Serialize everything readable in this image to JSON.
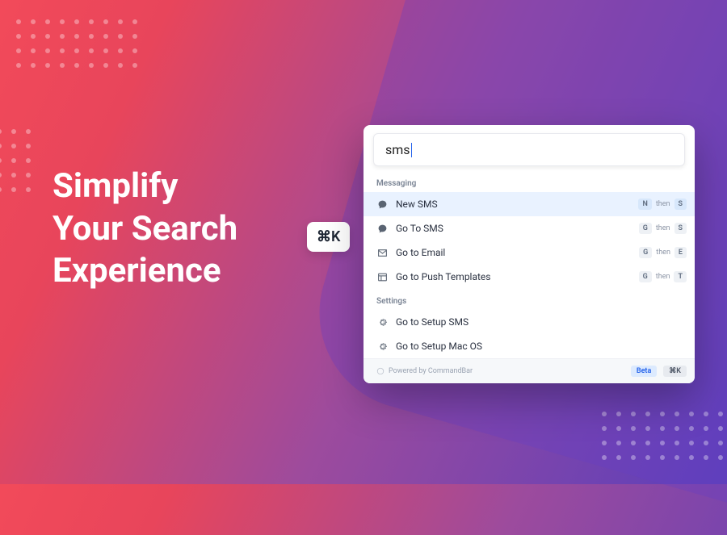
{
  "headline": {
    "line1": "Simplify",
    "line2": "Your Search",
    "line3": "Experience"
  },
  "shortcut_badge": "⌘K",
  "search": {
    "value": "sms",
    "placeholder": ""
  },
  "sections": [
    {
      "title": "Messaging",
      "items": [
        {
          "icon": "bubble",
          "label": "New SMS",
          "keys": [
            "N",
            "S"
          ],
          "selected": true
        },
        {
          "icon": "bubble",
          "label": "Go To SMS",
          "keys": [
            "G",
            "S"
          ]
        },
        {
          "icon": "mail",
          "label": "Go to Email",
          "keys": [
            "G",
            "E"
          ]
        },
        {
          "icon": "template",
          "label": "Go to Push Templates",
          "keys": [
            "G",
            "T"
          ]
        }
      ]
    },
    {
      "title": "Settings",
      "items": [
        {
          "icon": "gear",
          "label": "Go to Setup SMS"
        },
        {
          "icon": "gear",
          "label": "Go to Setup Mac OS"
        }
      ]
    }
  ],
  "footer": {
    "powered_by": "Powered by CommandBar",
    "beta": "Beta",
    "shortcut": "⌘K"
  },
  "key_separator": "then"
}
